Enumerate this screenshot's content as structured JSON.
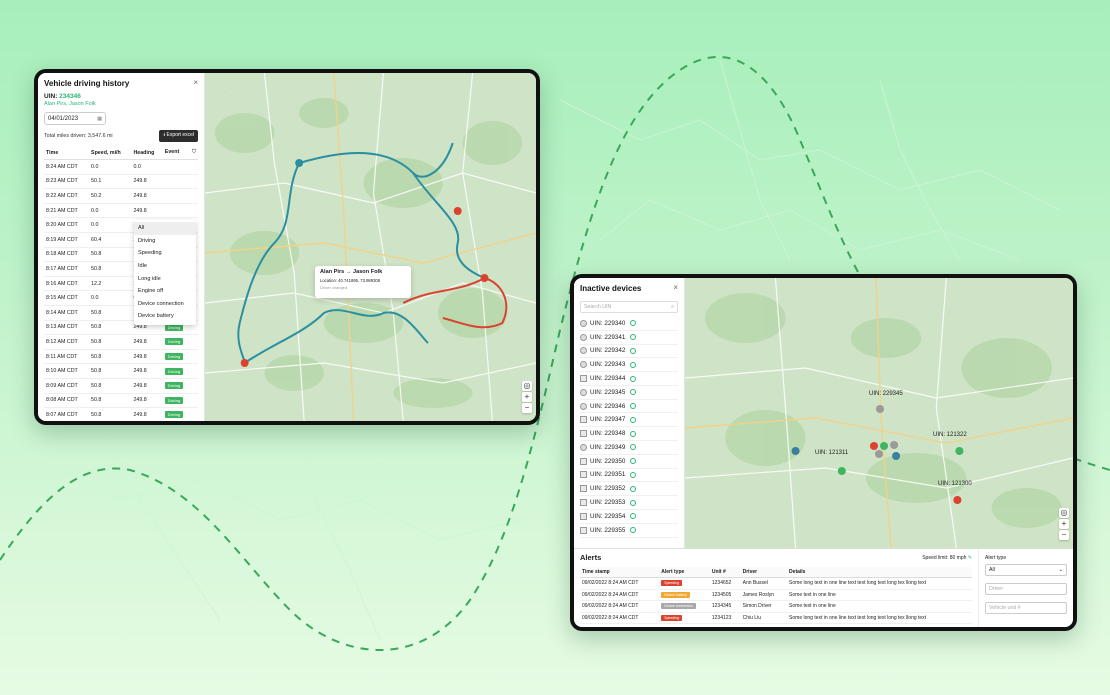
{
  "colors": {
    "accent": "#2bb673",
    "route_teal": "#2a8fa0",
    "route_red": "#d9432f"
  },
  "history": {
    "title": "Vehicle driving history",
    "close_icon": "×",
    "uin_label": "UIN:",
    "uin_value": "234346",
    "drivers": "Alan Pirs, Jason Folk",
    "date": "04/01/2023",
    "total_miles": "Total miles driven: 3,547.6 mi",
    "export_label": "Export excel",
    "columns": [
      "Time",
      "Speed, mi/h",
      "Heading",
      "Event"
    ],
    "rows": [
      {
        "time": "8:24 AM CDT",
        "speed": "0.0",
        "heading": "0.0",
        "event": "",
        "event_color": ""
      },
      {
        "time": "8:23 AM CDT",
        "speed": "50.1",
        "heading": "249.8",
        "event": "",
        "event_color": ""
      },
      {
        "time": "8:22 AM CDT",
        "speed": "50.2",
        "heading": "249.8",
        "event": "",
        "event_color": ""
      },
      {
        "time": "8:21 AM CDT",
        "speed": "0.0",
        "heading": "249.8",
        "event": "",
        "event_color": ""
      },
      {
        "time": "8:20 AM CDT",
        "speed": "0.0",
        "heading": "249.8",
        "event": "",
        "event_color": ""
      },
      {
        "time": "8:19 AM CDT",
        "speed": "60.4",
        "heading": "249.8",
        "event": "",
        "event_color": ""
      },
      {
        "time": "8:18 AM CDT",
        "speed": "50.8",
        "heading": "249.8",
        "event": "",
        "event_color": ""
      },
      {
        "time": "8:17 AM CDT",
        "speed": "50.8",
        "heading": "249.8",
        "event": "",
        "event_color": ""
      },
      {
        "time": "8:16 AM CDT",
        "speed": "12.2",
        "heading": "249.8",
        "event": "Engine off",
        "event_color": "gray"
      },
      {
        "time": "8:15 AM CDT",
        "speed": "0.0",
        "heading": "0.0",
        "event": "Long idle",
        "event_color": "teal"
      },
      {
        "time": "8:14 AM CDT",
        "speed": "50.8",
        "heading": "249.8",
        "event": "Driving",
        "event_color": ""
      },
      {
        "time": "8:13 AM CDT",
        "speed": "50.8",
        "heading": "249.8",
        "event": "Driving",
        "event_color": ""
      },
      {
        "time": "8:12 AM CDT",
        "speed": "50.8",
        "heading": "249.8",
        "event": "Driving",
        "event_color": ""
      },
      {
        "time": "8:11 AM CDT",
        "speed": "50.8",
        "heading": "249.8",
        "event": "Driving",
        "event_color": ""
      },
      {
        "time": "8:10 AM CDT",
        "speed": "50.8",
        "heading": "249.8",
        "event": "Driving",
        "event_color": ""
      },
      {
        "time": "8:09 AM CDT",
        "speed": "50.8",
        "heading": "249.8",
        "event": "Driving",
        "event_color": ""
      },
      {
        "time": "8:08 AM CDT",
        "speed": "50.8",
        "heading": "249.8",
        "event": "Driving",
        "event_color": ""
      },
      {
        "time": "8:07 AM CDT",
        "speed": "50.8",
        "heading": "249.8",
        "event": "Driving",
        "event_color": ""
      }
    ],
    "event_filter_options": [
      "All",
      "Driving",
      "Speeding",
      "Idle",
      "Long idle",
      "Engine off",
      "Device connection",
      "Device battery"
    ],
    "popup": {
      "from": "Alan Pirs",
      "to": "Jason Folk",
      "location": "Location: 40.741895, 73.989308",
      "note": "Driver changed"
    }
  },
  "inactive": {
    "title": "Inactive devices",
    "close_icon": "×",
    "search_placeholder": "Search UIN",
    "items": [
      {
        "label": "UIN: 229340",
        "type": "dot"
      },
      {
        "label": "UIN: 229341",
        "type": "dot"
      },
      {
        "label": "UIN: 229342",
        "type": "dot"
      },
      {
        "label": "UIN: 229343",
        "type": "dot"
      },
      {
        "label": "UIN: 229344",
        "type": "box"
      },
      {
        "label": "UIN: 229345",
        "type": "dot"
      },
      {
        "label": "UIN: 229346",
        "type": "dot"
      },
      {
        "label": "UIN: 229347",
        "type": "box"
      },
      {
        "label": "UIN: 229348",
        "type": "box"
      },
      {
        "label": "UIN: 229349",
        "type": "dot"
      },
      {
        "label": "UIN: 229350",
        "type": "box"
      },
      {
        "label": "UIN: 229351",
        "type": "box"
      },
      {
        "label": "UIN: 229352",
        "type": "box"
      },
      {
        "label": "UIN: 229353",
        "type": "box"
      },
      {
        "label": "UIN: 229354",
        "type": "box"
      },
      {
        "label": "UIN: 229355",
        "type": "box"
      }
    ],
    "map_labels": [
      "UIN: 229345",
      "UIN: 121322",
      "UIN: 121311",
      "UIN: 121300"
    ]
  },
  "alerts": {
    "title": "Alerts",
    "speed_limit": "Speed limit: 80 mph",
    "columns": [
      "Time stamp",
      "Alert type",
      "Unit #",
      "Driver",
      "Details"
    ],
    "rows": [
      {
        "time": "09/02/2022  8:24 AM CDT",
        "alert": "Speeding",
        "alert_color": "#d9432f",
        "unit": "1234652",
        "driver": "Ann Bussel",
        "details": "Some long text in one line text text long text long tex llong text"
      },
      {
        "time": "09/02/2022  8:24 AM CDT",
        "alert": "Device battery",
        "alert_color": "#f0a830",
        "unit": "1234505",
        "driver": "James Roslyn",
        "details": "Some text in one line"
      },
      {
        "time": "09/02/2022  8:24 AM CDT",
        "alert": "Device connection",
        "alert_color": "#a8a8a8",
        "unit": "1234345",
        "driver": "Simon Driver",
        "details": "Some text in one line"
      },
      {
        "time": "09/02/2022  8:24 AM CDT",
        "alert": "Speeding",
        "alert_color": "#d9432f",
        "unit": "1234123",
        "driver": "Chiu Liu",
        "details": "Some long text in one line text text long text long tex llong text"
      }
    ],
    "filters": {
      "alert_type_label": "Alert type",
      "alert_type_value": "All",
      "driver_placeholder": "Driver",
      "unit_placeholder": "Vehicle unit #"
    }
  }
}
